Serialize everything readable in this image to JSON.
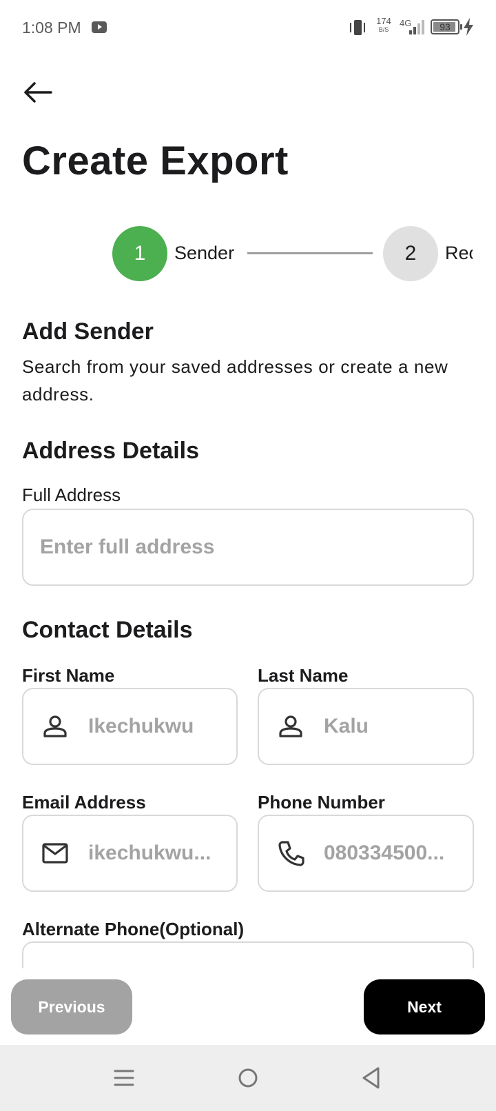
{
  "status_bar": {
    "time": "1:08 PM",
    "speed_value": "174",
    "speed_unit": "B/S",
    "network": "4G",
    "battery": "93",
    "battery_level": 0.93
  },
  "page": {
    "title": "Create Export"
  },
  "stepper": {
    "steps": [
      {
        "number": "1",
        "label": "Sender",
        "state": "active",
        "color": "#4caf50"
      },
      {
        "number": "2",
        "label": "Receiver",
        "state": "inactive",
        "color": "#e0e0e0"
      }
    ]
  },
  "sender": {
    "title": "Add Sender",
    "description": "Search from your saved addresses or create a new address."
  },
  "address": {
    "title": "Address Details",
    "full_address_label": "Full Address",
    "full_address_placeholder": "Enter full address"
  },
  "contact": {
    "title": "Contact Details",
    "first_name_label": "First Name",
    "first_name_placeholder": "Ikechukwu",
    "last_name_label": "Last Name",
    "last_name_placeholder": "Kalu",
    "email_label": "Email Address",
    "email_placeholder": "ikechukwu...",
    "phone_label": "Phone Number",
    "phone_placeholder": "080334500...",
    "alt_phone_label": "Alternate Phone(Optional)"
  },
  "actions": {
    "previous": "Previous",
    "next": "Next"
  },
  "icons": {
    "back": "arrow-left-icon",
    "person": "person-icon",
    "mail": "mail-icon",
    "phone": "phone-icon"
  }
}
